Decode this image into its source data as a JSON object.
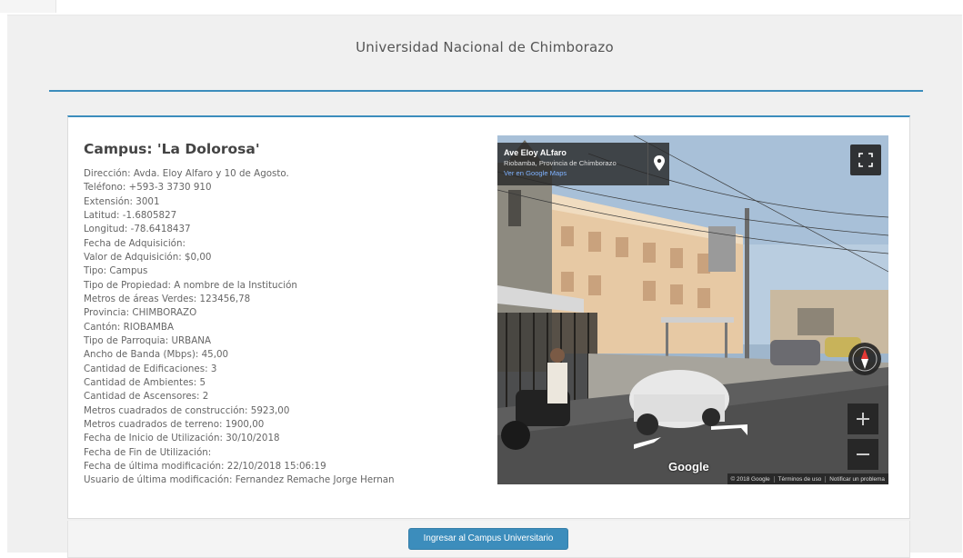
{
  "header": {
    "title": "Universidad Nacional de Chimborazo"
  },
  "campus": {
    "title": "Campus: 'La Dolorosa'",
    "details": [
      "Dirección: Avda. Eloy Alfaro y 10 de Agosto.",
      "Teléfono: +593-3 3730 910",
      "Extensión: 3001",
      "Latitud: -1.6805827",
      "Longitud: -78.6418437",
      "Fecha de Adquisición:",
      "Valor de Adquisición: $0,00",
      "Tipo: Campus",
      "Tipo de Propiedad: A nombre de la Institución",
      "Metros de áreas Verdes: 123456,78",
      "Provincia: CHIMBORAZO",
      "Cantón: RIOBAMBA",
      "Tipo de Parroquia: URBANA",
      "Ancho de Banda (Mbps): 45,00",
      "Cantidad de Edificaciones: 3",
      "Cantidad de Ambientes: 5",
      "Cantidad de Ascensores: 2",
      "Metros cuadrados de construcción: 5923,00",
      "Metros cuadrados de terreno: 1900,00",
      "Fecha de Inicio de Utilización: 30/10/2018",
      "Fecha de Fin de Utilización:",
      "Fecha de última modificación: 22/10/2018 15:06:19",
      "Usuario de última modificación: Fernandez Remache Jorge Hernan"
    ]
  },
  "streetview": {
    "address_name": "Ave Eloy ALfaro",
    "address_region": "Riobamba, Provincia de Chimborazo",
    "address_link": "Ver en Google Maps",
    "logo": "Google",
    "attribution": [
      "© 2018 Google",
      "Términos de uso",
      "Notificar un problema"
    ],
    "icons": [
      "map-pin-icon",
      "fullscreen-icon",
      "compass-icon",
      "zoom-in-icon",
      "zoom-out-icon"
    ]
  },
  "footer": {
    "button_label": "Ingresar al Campus Universitario"
  },
  "colors": {
    "accent": "#3c8dbc",
    "background": "#f0f0f0",
    "panel": "#ffffff"
  }
}
